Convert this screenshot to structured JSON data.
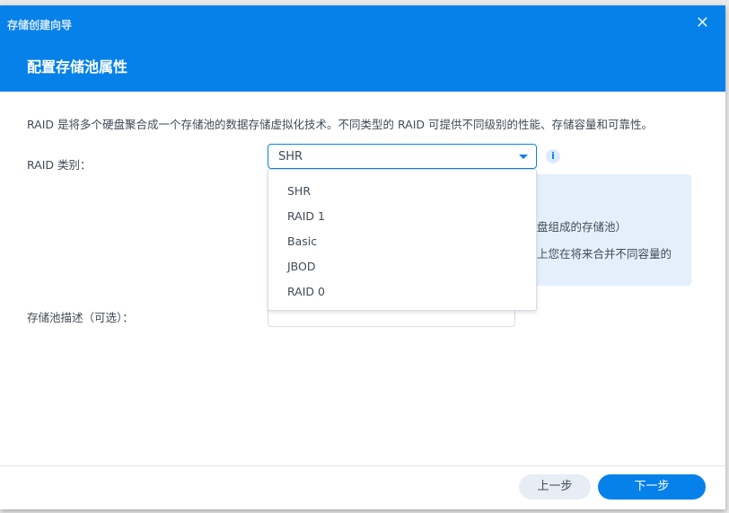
{
  "window": {
    "title": "存储创建向导",
    "close_icon": "close-icon"
  },
  "step_title": "配置存储池属性",
  "description": "RAID 是将多个硬盘聚合成一个存储池的数据存储虚拟化技术。不同类型的 RAID 可提供不同级别的性能、存储容量和可靠性。",
  "raid_type": {
    "label": "RAID 类别：",
    "value": "SHR",
    "options": [
      "SHR",
      "RAID 1",
      "Basic",
      "JBOD",
      "RAID 0"
    ]
  },
  "tip": {
    "line1": "盘组成的存储池）",
    "line2": "上您在将来合并不同容量的"
  },
  "pool_desc": {
    "label": "存储池描述（可选）：",
    "value": ""
  },
  "footer": {
    "prev": "上一步",
    "next": "下一步"
  },
  "colors": {
    "accent": "#0781ea"
  }
}
